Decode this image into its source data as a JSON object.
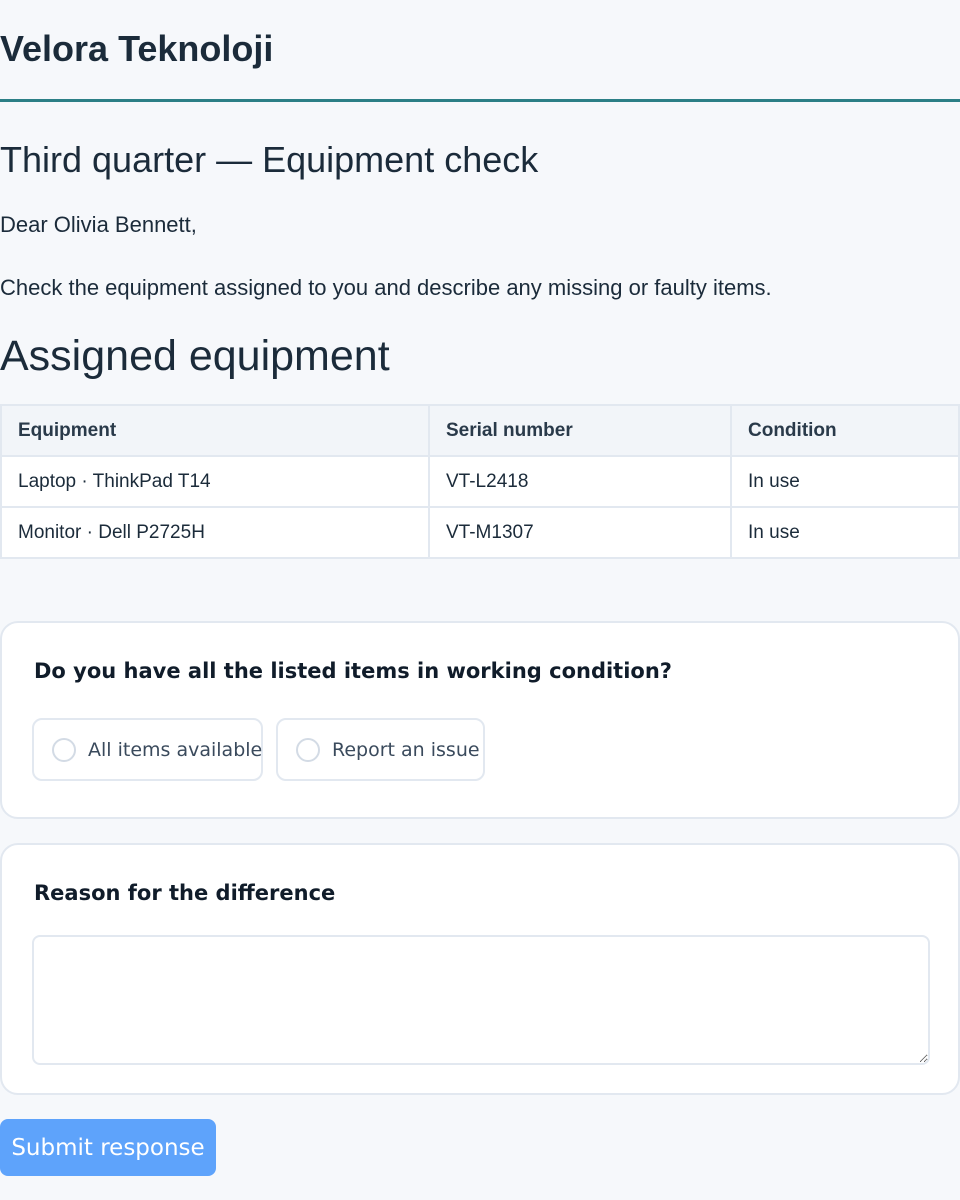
{
  "brand": {
    "name": "Velora Teknoloji"
  },
  "page": {
    "title": "Third quarter — Equipment check",
    "greeting": "Dear Olivia Bennett,",
    "instructions": "Check the equipment assigned to you and describe any missing or faulty items."
  },
  "equipment": {
    "heading": "Assigned equipment",
    "columns": [
      "Equipment",
      "Serial number",
      "Condition"
    ],
    "rows": [
      [
        "Laptop · ThinkPad T14",
        "VT-L2418",
        "In use"
      ],
      [
        "Monitor · Dell P2725H",
        "VT-M1307",
        "In use"
      ]
    ]
  },
  "question": {
    "label": "Do you have all the listed items in working condition?",
    "options": [
      "All items available",
      "Report an issue"
    ]
  },
  "reason": {
    "label": "Reason for the difference",
    "value": ""
  },
  "submit": {
    "label": "Submit response"
  },
  "colors": {
    "accent": "#2b7f86",
    "button": "#5ea3fb",
    "background": "#f6f8fb"
  }
}
